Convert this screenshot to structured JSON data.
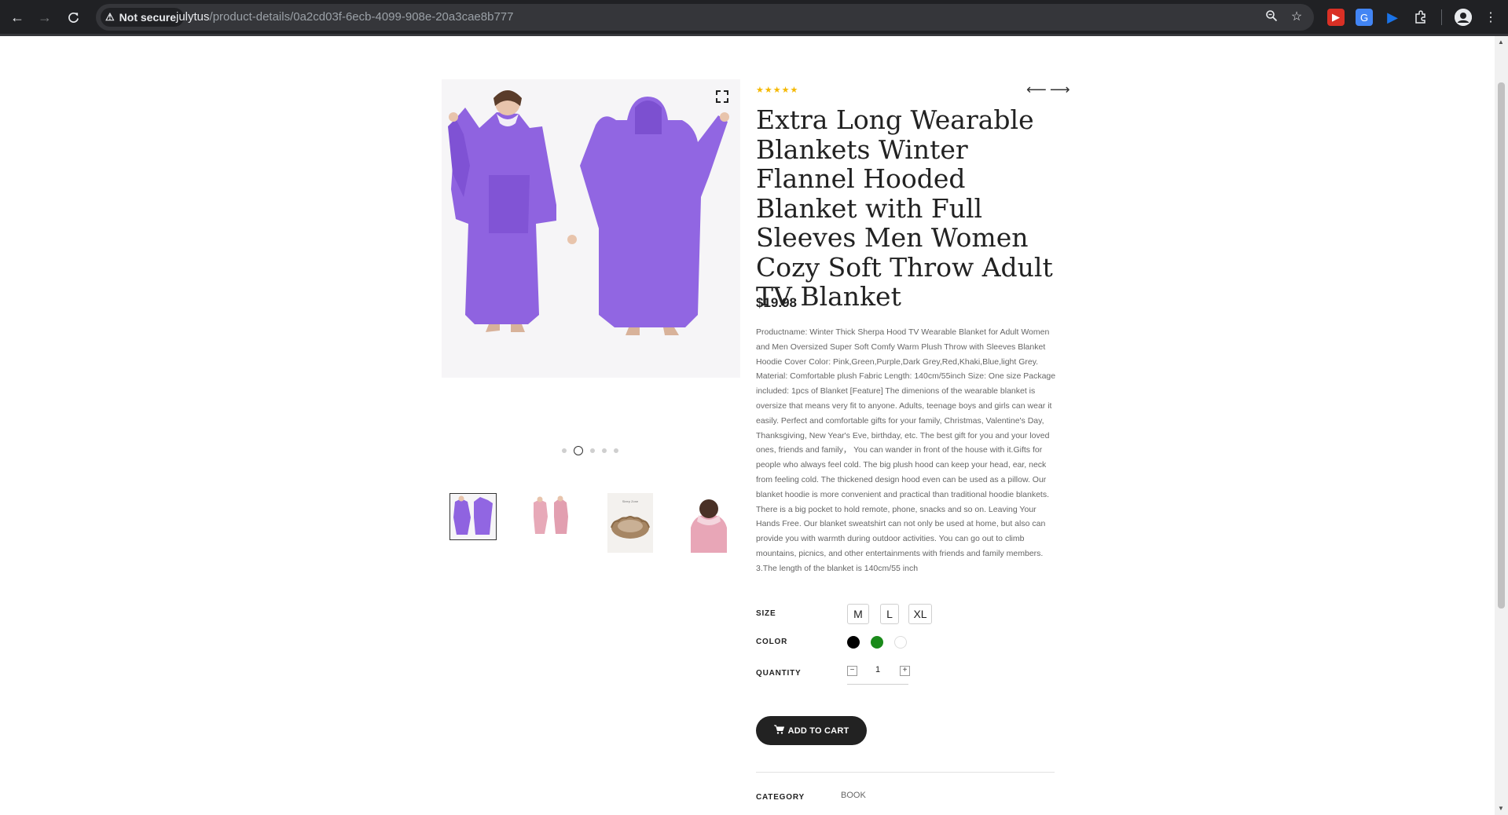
{
  "browser": {
    "security_label": "Not secure",
    "url_host": "julytus",
    "url_path": "/product-details/0a2cd03f-6ecb-4099-908e-20a3cae8b777",
    "icons": [
      "back-icon",
      "forward-icon",
      "reload-icon",
      "warning-icon",
      "zoom-icon",
      "star-icon",
      "extension-icon",
      "profile-icon",
      "menu-icon"
    ]
  },
  "product": {
    "rating_stars": "★★★★★",
    "rating_value": 5,
    "nav_prev": "⟵",
    "nav_next": "⟶",
    "title": "Extra Long Wearable Blankets Winter Flannel Hooded Blanket with Full Sleeves Men Women Cozy Soft Throw Adult TV Blanket",
    "price": "$19.98",
    "description": "Productname: Winter Thick Sherpa Hood TV Wearable Blanket for Adult Women and Men Oversized Super Soft Comfy Warm Plush Throw with Sleeves Blanket Hoodie Cover Color: Pink,Green,Purple,Dark Grey,Red,Khaki,Blue,light Grey. Material: Comfortable plush Fabric Length: 140cm/55inch Size: One size Package included: 1pcs of Blanket [Feature] The dimenions of the wearable blanket is oversize that means very fit to anyone. Adults, teenage boys and girls can wear it easily. Perfect and comfortable gifts for your family, Christmas, Valentine's Day, Thanksgiving, New Year's Eve, birthday, etc. The best gift for you and your loved ones, friends and family， You can wander in front of the house with it.Gifts for people who always feel cold. The big plush hood can keep your head, ear, neck from feeling cold. The thickened design hood even can be used as a pillow. Our blanket hoodie is more convenient and practical than traditional hoodie blankets. There is a big pocket to hold remote, phone, snacks and so on. Leaving Your Hands Free. Our blanket sweatshirt can not only be used at home, but also can provide you with warmth during outdoor activities. You can go out to climb mountains, picnics, and other entertainments with friends and family members. 3.The length of the blanket is 140cm/55 inch",
    "size_label": "SIZE",
    "sizes": [
      "M",
      "L",
      "XL"
    ],
    "color_label": "COLOR",
    "colors": [
      "#000000",
      "#1a8a1a",
      "#ffffff"
    ],
    "quantity_label": "QUANTITY",
    "quantity": "1",
    "qty_minus": "−",
    "qty_plus": "+",
    "add_to_cart": "ADD TO CART",
    "category_label": "CATEGORY",
    "category_value": "BOOK",
    "gallery": {
      "slide_count": 5,
      "active_slide": 2,
      "thumbnail_count": 4,
      "selected_thumbnail": 1,
      "thumbnail_text": "Sleep Zone"
    }
  }
}
